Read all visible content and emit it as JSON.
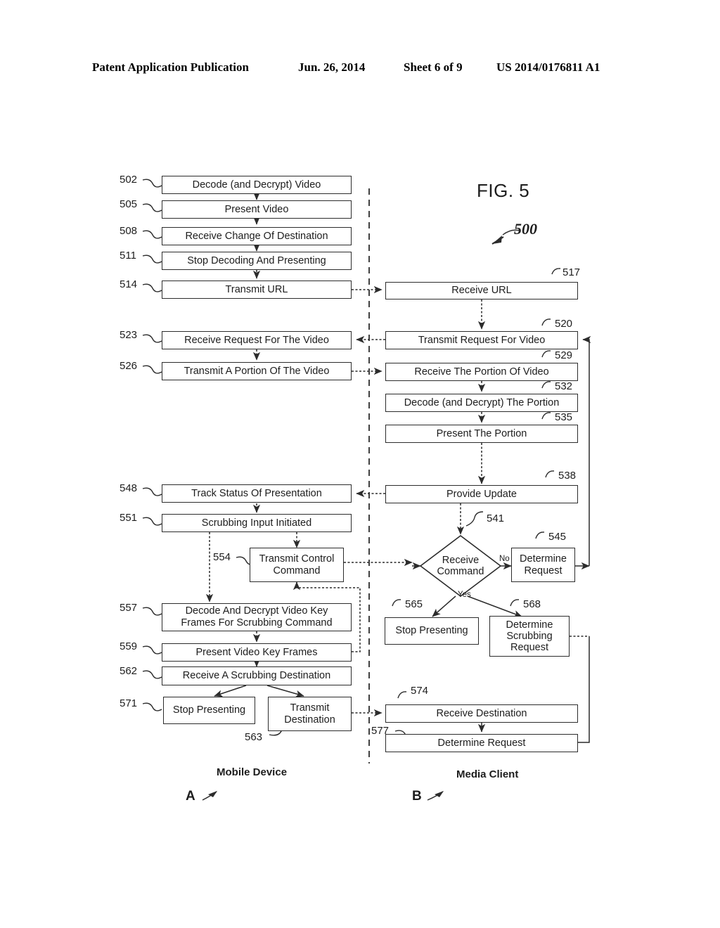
{
  "header": {
    "title": "Patent Application Publication",
    "date": "Jun. 26, 2014",
    "sheet": "Sheet 6 of 9",
    "patent_number": "US 2014/0176811 A1"
  },
  "figure": {
    "label": "FIG. 5",
    "reference": "500"
  },
  "lanes": [
    {
      "name": "Mobile Device",
      "connector": "A"
    },
    {
      "name": "Media Client",
      "connector": "B"
    }
  ],
  "branch_labels": {
    "no": "No",
    "yes": "Yes"
  },
  "nodes": [
    {
      "ref": "502",
      "label": "Decode (and Decrypt) Video",
      "lane": "mobile",
      "shape": "process"
    },
    {
      "ref": "505",
      "label": "Present Video",
      "lane": "mobile",
      "shape": "process"
    },
    {
      "ref": "508",
      "label": "Receive Change Of Destination",
      "lane": "mobile",
      "shape": "process"
    },
    {
      "ref": "511",
      "label": "Stop Decoding And Presenting",
      "lane": "mobile",
      "shape": "process"
    },
    {
      "ref": "514",
      "label": "Transmit URL",
      "lane": "mobile",
      "shape": "process"
    },
    {
      "ref": "517",
      "label": "Receive URL",
      "lane": "client",
      "shape": "process"
    },
    {
      "ref": "520",
      "label": "Transmit Request For Video",
      "lane": "client",
      "shape": "process"
    },
    {
      "ref": "523",
      "label": "Receive Request For The Video",
      "lane": "mobile",
      "shape": "process"
    },
    {
      "ref": "526",
      "label": "Transmit A Portion Of The Video",
      "lane": "mobile",
      "shape": "process"
    },
    {
      "ref": "529",
      "label": "Receive The Portion Of Video",
      "lane": "client",
      "shape": "process"
    },
    {
      "ref": "532",
      "label": "Decode (and Decrypt) The Portion",
      "lane": "client",
      "shape": "process"
    },
    {
      "ref": "535",
      "label": "Present The Portion",
      "lane": "client",
      "shape": "process"
    },
    {
      "ref": "538",
      "label": "Provide Update",
      "lane": "client",
      "shape": "process"
    },
    {
      "ref": "541",
      "label": "Receive Command",
      "lane": "client",
      "shape": "decision"
    },
    {
      "ref": "545",
      "label": "Determine Request",
      "lane": "client",
      "shape": "process"
    },
    {
      "ref": "548",
      "label": "Track Status Of Presentation",
      "lane": "mobile",
      "shape": "process"
    },
    {
      "ref": "551",
      "label": "Scrubbing Input Initiated",
      "lane": "mobile",
      "shape": "process"
    },
    {
      "ref": "554",
      "label": "Transmit Control Command",
      "lane": "mobile",
      "shape": "process"
    },
    {
      "ref": "557",
      "label": "Decode And Decrypt Video Key Frames For Scrubbing Command",
      "lane": "mobile",
      "shape": "process"
    },
    {
      "ref": "559",
      "label": "Present Video Key Frames",
      "lane": "mobile",
      "shape": "process"
    },
    {
      "ref": "562",
      "label": "Receive A Scrubbing Destination",
      "lane": "mobile",
      "shape": "process"
    },
    {
      "ref": "563",
      "label": "Transmit Destination",
      "lane": "mobile",
      "shape": "process"
    },
    {
      "ref": "565",
      "label": "Stop Presenting",
      "lane": "client",
      "shape": "process"
    },
    {
      "ref": "568",
      "label": "Determine Scrubbing Request",
      "lane": "client",
      "shape": "process"
    },
    {
      "ref": "571",
      "label": "Stop Presenting",
      "lane": "mobile",
      "shape": "process"
    },
    {
      "ref": "574",
      "label": "Receive Destination",
      "lane": "client",
      "shape": "process"
    },
    {
      "ref": "577",
      "label": "Determine Request",
      "lane": "client",
      "shape": "process"
    }
  ],
  "text": {
    "n502": "Decode (and Decrypt) Video",
    "n505": "Present Video",
    "n508": "Receive Change Of Destination",
    "n511": "Stop Decoding And Presenting",
    "n514": "Transmit URL",
    "n517": "Receive URL",
    "n520": "Transmit Request For Video",
    "n523": "Receive Request For The Video",
    "n526": "Transmit A Portion Of The Video",
    "n529": "Receive The Portion Of Video",
    "n532": "Decode (and Decrypt) The Portion",
    "n535": "Present The Portion",
    "n538": "Provide Update",
    "n541a": "Receive",
    "n541b": "Command",
    "n545a": "Determine",
    "n545b": "Request",
    "n548": "Track Status Of Presentation",
    "n551": "Scrubbing Input Initiated",
    "n554a": "Transmit Control",
    "n554b": "Command",
    "n557a": "Decode And Decrypt Video Key",
    "n557b": "Frames For Scrubbing Command",
    "n559": "Present Video Key Frames",
    "n562": "Receive A Scrubbing Destination",
    "n563a": "Transmit",
    "n563b": "Destination",
    "n565": "Stop Presenting",
    "n568a": "Determine",
    "n568b": "Scrubbing",
    "n568c": "Request",
    "n571": "Stop Presenting",
    "n574": "Receive Destination",
    "n577": "Determine Request"
  },
  "refs": {
    "r502": "502",
    "r505": "505",
    "r508": "508",
    "r511": "511",
    "r514": "514",
    "r517": "517",
    "r520": "520",
    "r523": "523",
    "r526": "526",
    "r529": "529",
    "r532": "532",
    "r535": "535",
    "r538": "538",
    "r541": "541",
    "r545": "545",
    "r548": "548",
    "r551": "551",
    "r554": "554",
    "r557": "557",
    "r559": "559",
    "r562": "562",
    "r563": "563",
    "r565": "565",
    "r568": "568",
    "r571": "571",
    "r574": "574",
    "r577": "577"
  },
  "colors": {
    "ink": "#1d1d1d",
    "box_border": "#2c2c2c",
    "background": "#ffffff"
  }
}
